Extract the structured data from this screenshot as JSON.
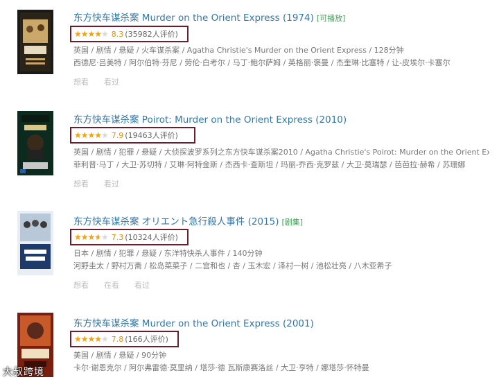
{
  "results": [
    {
      "title": "东方快车谋杀案 Murder on the Orient Express (1974)",
      "tag": "[可播放]",
      "rating": 4.15,
      "score": "8.3",
      "count": "(35982人评价)",
      "meta1": "英国 / 剧情 / 悬疑 / 火车谋杀案 / Agatha Christie's Murder on the Orient Express / 128分钟",
      "meta2": "西德尼·吕美特 / 阿尔伯特·芬尼 / 劳伦·白考尔 / 马丁·鲍尔萨姆 / 英格丽·褒曼 / 杰奎琳·比塞特 / 让-皮埃尔·卡塞尔",
      "actions": [
        "想看",
        "看过"
      ]
    },
    {
      "title": "东方快车谋杀案 Poirot: Murder on the Orient Express (2010)",
      "tag": "",
      "rating": 3.95,
      "score": "7.9",
      "count": "(19463人评价)",
      "meta1": "英国 / 剧情 / 犯罪 / 悬疑 / 大侦探波罗系列之东方快车谋杀案2010 / Agatha Christie's Poirot: Murder on the Orient Express",
      "meta2": "菲利普·马丁 / 大卫·苏切特 / 艾琳·阿特金斯 / 杰西卡·查斯坦 / 玛丽-乔西·克罗兹 / 大卫·莫瑞瑟 / 芭芭拉·赫希 / 苏珊娜",
      "actions": [
        "想看",
        "看过"
      ]
    },
    {
      "title": "东方快车谋杀案 オリエント急行殺人事件 (2015)",
      "tag": "[剧集]",
      "rating": 3.65,
      "score": "7.3",
      "count": "(10324人评价)",
      "meta1": "日本 / 剧情 / 犯罪 / 悬疑 / 东洋特快杀人事件 / 140分钟",
      "meta2": "河野圭太 / 野村万斋 / 松岛菜菜子 / 二宫和也 / 杏 / 玉木宏 / 泽村一树 / 池松壮亮 / 八木亚希子",
      "actions": [
        "想看",
        "在看",
        "看过"
      ]
    },
    {
      "title": "东方快车谋杀案 Murder on the Orient Express (2001)",
      "tag": "",
      "rating": 3.9,
      "score": "7.8",
      "count": "(166人评价)",
      "meta1": "美国 / 剧情 / 悬疑 / 90分钟",
      "meta2": "卡尔·谢恩克尔 / 阿尔弗雷德·莫里纳 / 塔莎·德 瓦斯康赛洛丝 / 大卫·亨特 / 娜塔莎·怀特曼",
      "actions": []
    }
  ],
  "star_glyphs": "★★★★★",
  "watermark": "大叔跨境",
  "colors": {
    "title": "#3377aa",
    "star": "#f6a10d",
    "highlight_box": "#6e1c2c",
    "tag": "#3fa156"
  }
}
